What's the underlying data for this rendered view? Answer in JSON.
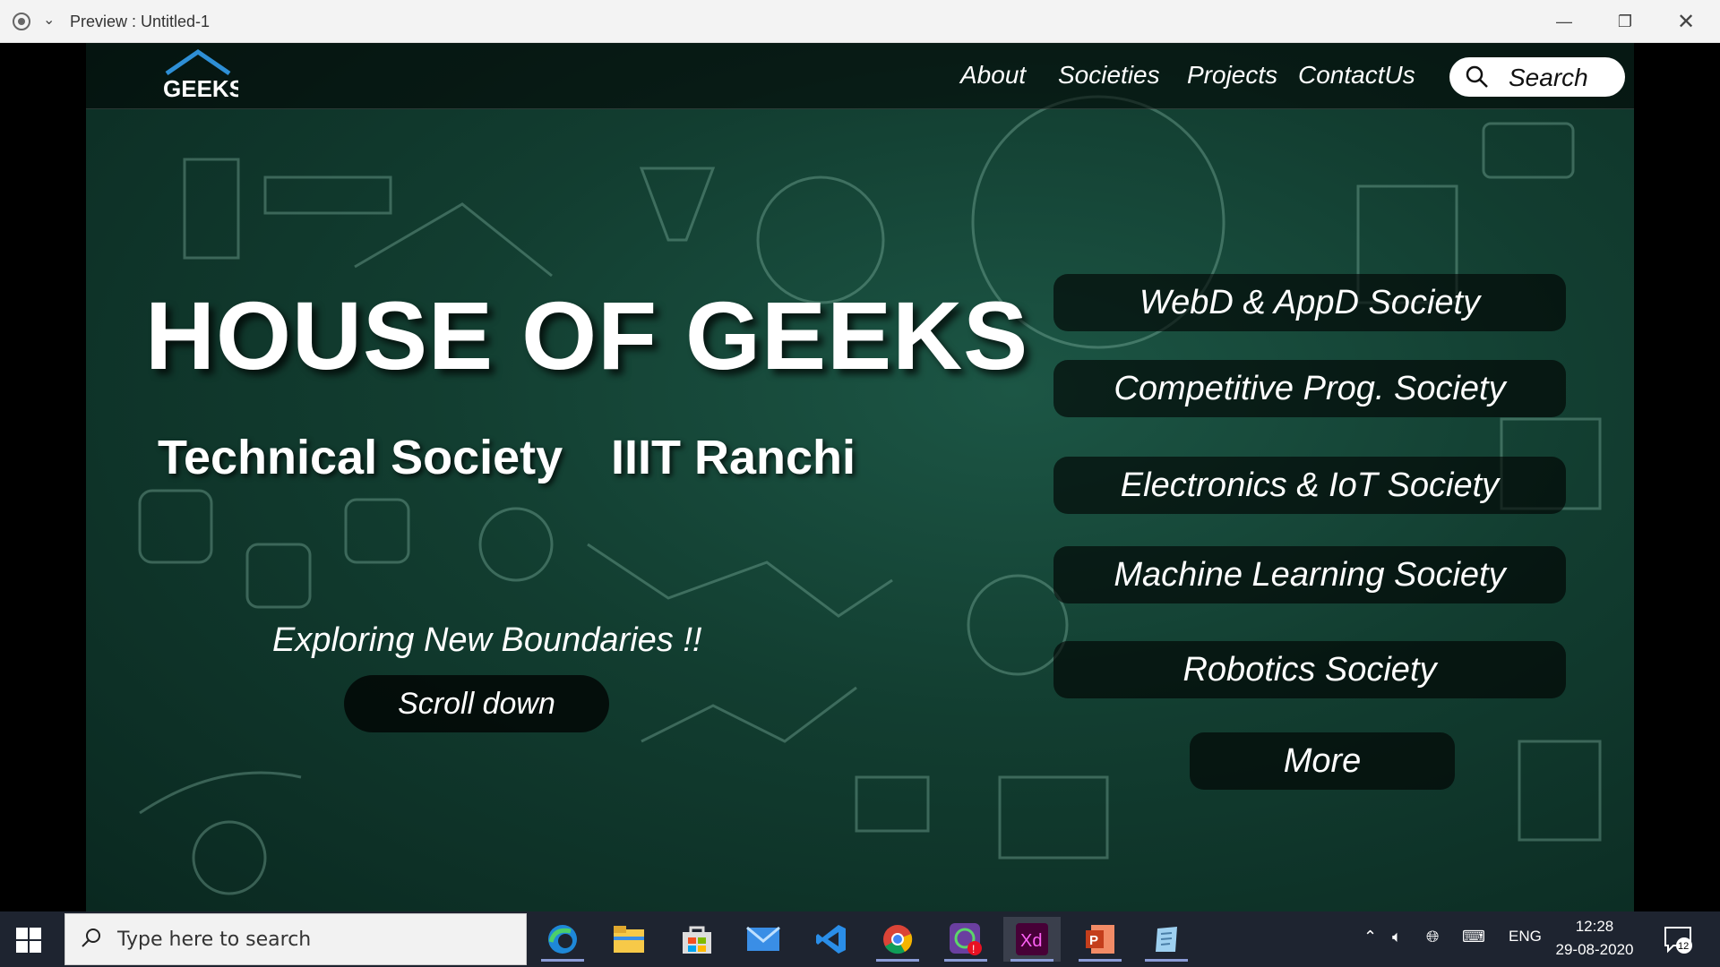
{
  "window": {
    "title": "Preview : Untitled-1",
    "controls": [
      "minimize-icon",
      "restore-icon",
      "close-icon"
    ]
  },
  "site": {
    "logo_text": "GEEKS",
    "nav": [
      "About",
      "Societies",
      "Projects",
      "ContactUs"
    ],
    "search_label": "Search",
    "hero_title": "HOUSE OF GEEKS",
    "hero_sub_left": "Technical Society",
    "hero_sub_right": "IIIT Ranchi",
    "tagline": "Exploring New Boundaries !!",
    "scroll_label": "Scroll down",
    "societies": [
      "WebD & AppD Society",
      "Competitive Prog. Society",
      "Electronics & IoT Society",
      "Machine Learning Society",
      "Robotics Society"
    ],
    "more_label": "More"
  },
  "taskbar": {
    "search_placeholder": "Type here to search",
    "apps": [
      "edge-icon",
      "file-explorer-icon",
      "store-icon",
      "mail-icon",
      "vscode-icon",
      "chrome-icon",
      "whatsapp-icon",
      "adobe-xd-icon",
      "powerpoint-icon",
      "notepad-icon"
    ],
    "xd_label": "Xd",
    "language": "ENG",
    "time": "12:28",
    "date": "29-08-2020",
    "notification_count": "12"
  },
  "colors": {
    "bg_dark_green": "#123d30",
    "logo_blue": "#2e8fd6",
    "taskbar": "#1e2430"
  }
}
